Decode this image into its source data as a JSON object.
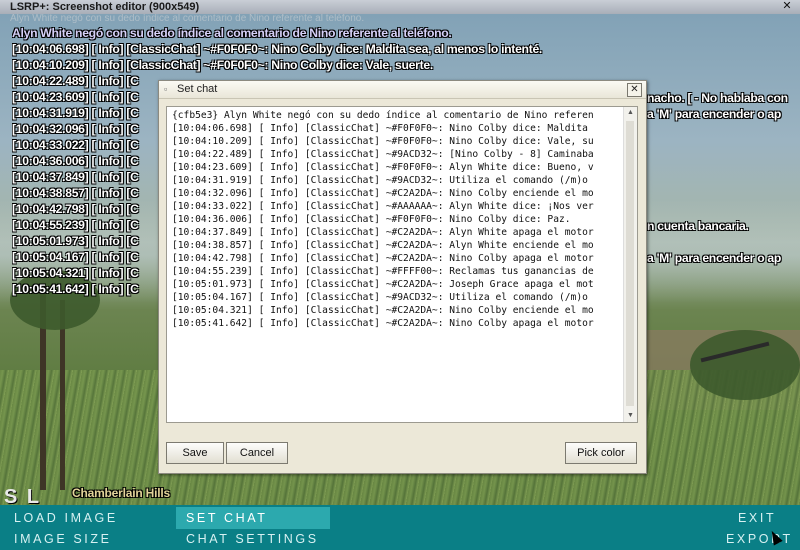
{
  "window": {
    "title": "LSRP+: Screenshot editor (900x549)",
    "close_glyph": "✕",
    "ghost_text": "Alyn White negó con su dedo índice al comentario de Nino referente al teléfono."
  },
  "scene": {
    "location": "Chamberlain Hills",
    "radar_fragment": "S L"
  },
  "chat_overlay": [
    "Alyn White negó con su dedo índice al comentario de Nino referente al teléfono.",
    "[10:04:06.698] [ Info] [ClassicChat] ~#F0F0F0~: Nino Colby dice: Maldita sea, al menos lo intenté.",
    "[10:04:10.209] [ Info] [ClassicChat] ~#F0F0F0~: Nino Colby dice: Vale, suerte.",
    "[10:04:22.489] [ Info] [C",
    "[10:04:23.609] [ Info] [C",
    "[10:04:31.919] [ Info] [C",
    "[10:04:32.096] [ Info] [C",
    "[10:04:33.022] [ Info] [C",
    "[10:04:36.006] [ Info] [C",
    "[10:04:37.849] [ Info] [C",
    "[10:04:38.857] [ Info] [C",
    "[10:04:42.798] [ Info] [C",
    "[10:04:55.239] [ Info] [C",
    "[10:05:01.973] [ Info] [C",
    "[10:05:04.167] [ Info] [C",
    "[10:05:04.321] [ Info] [C",
    "[10:05:41.642] [ Info] [C"
  ],
  "chat_right_fragments": [
    "nacho. [ - No hablaba con",
    "a 'M' para encender o ap",
    "n cuenta bancaria.",
    "a 'M' para encender o ap"
  ],
  "dialog": {
    "title": "Set chat",
    "close_glyph": "✕",
    "lines": [
      "{cfb5e3} Alyn White negó con su dedo índice al comentario de Nino referen",
      "[10:04:06.698] [ Info] [ClassicChat] ~#F0F0F0~: Nino Colby dice: Maldita",
      "[10:04:10.209] [ Info] [ClassicChat] ~#F0F0F0~: Nino Colby dice: Vale, su",
      "[10:04:22.489] [ Info] [ClassicChat] ~#9ACD32~: [Nino Colby - 8] Caminaba",
      "[10:04:23.609] [ Info] [ClassicChat] ~#F0F0F0~: Alyn White dice: Bueno, v",
      "[10:04:31.919] [ Info] [ClassicChat] ~#9ACD32~: Utiliza el comando (/m)o",
      "[10:04:32.096] [ Info] [ClassicChat] ~#C2A2DA~: Nino Colby enciende el mo",
      "[10:04:33.022] [ Info] [ClassicChat] ~#AAAAAA~: Alyn White dice: ¡Nos ver",
      "[10:04:36.006] [ Info] [ClassicChat] ~#F0F0F0~: Nino Colby dice: Paz.",
      "[10:04:37.849] [ Info] [ClassicChat] ~#C2A2DA~: Alyn White apaga el motor",
      "[10:04:38.857] [ Info] [ClassicChat] ~#C2A2DA~: Alyn White enciende el mo",
      "[10:04:42.798] [ Info] [ClassicChat] ~#C2A2DA~: Nino Colby apaga el motor",
      "[10:04:55.239] [ Info] [ClassicChat] ~#FFFF00~: Reclamas tus ganancias de",
      "[10:05:01.973] [ Info] [ClassicChat] ~#C2A2DA~: Joseph Grace apaga el mot",
      "[10:05:04.167] [ Info] [ClassicChat] ~#9ACD32~: Utiliza el comando (/m)o",
      "[10:05:04.321] [ Info] [ClassicChat] ~#C2A2DA~: Nino Colby enciende el mo",
      "[10:05:41.642] [ Info] [ClassicChat] ~#C2A2DA~: Nino Colby apaga el motor"
    ],
    "save_label": "Save",
    "cancel_label": "Cancel",
    "pick_color_label": "Pick color"
  },
  "menu": {
    "load_image": "LOAD IMAGE",
    "image_size": "IMAGE SIZE",
    "set_chat": "SET CHAT",
    "chat_settings": "CHAT SETTINGS",
    "exit": "EXIT",
    "export": "EXPORT"
  },
  "colors": {
    "menu_bg": "#0a7f86",
    "menu_active": "#2ca9ae",
    "dialog_bg": "#ece8d8"
  }
}
